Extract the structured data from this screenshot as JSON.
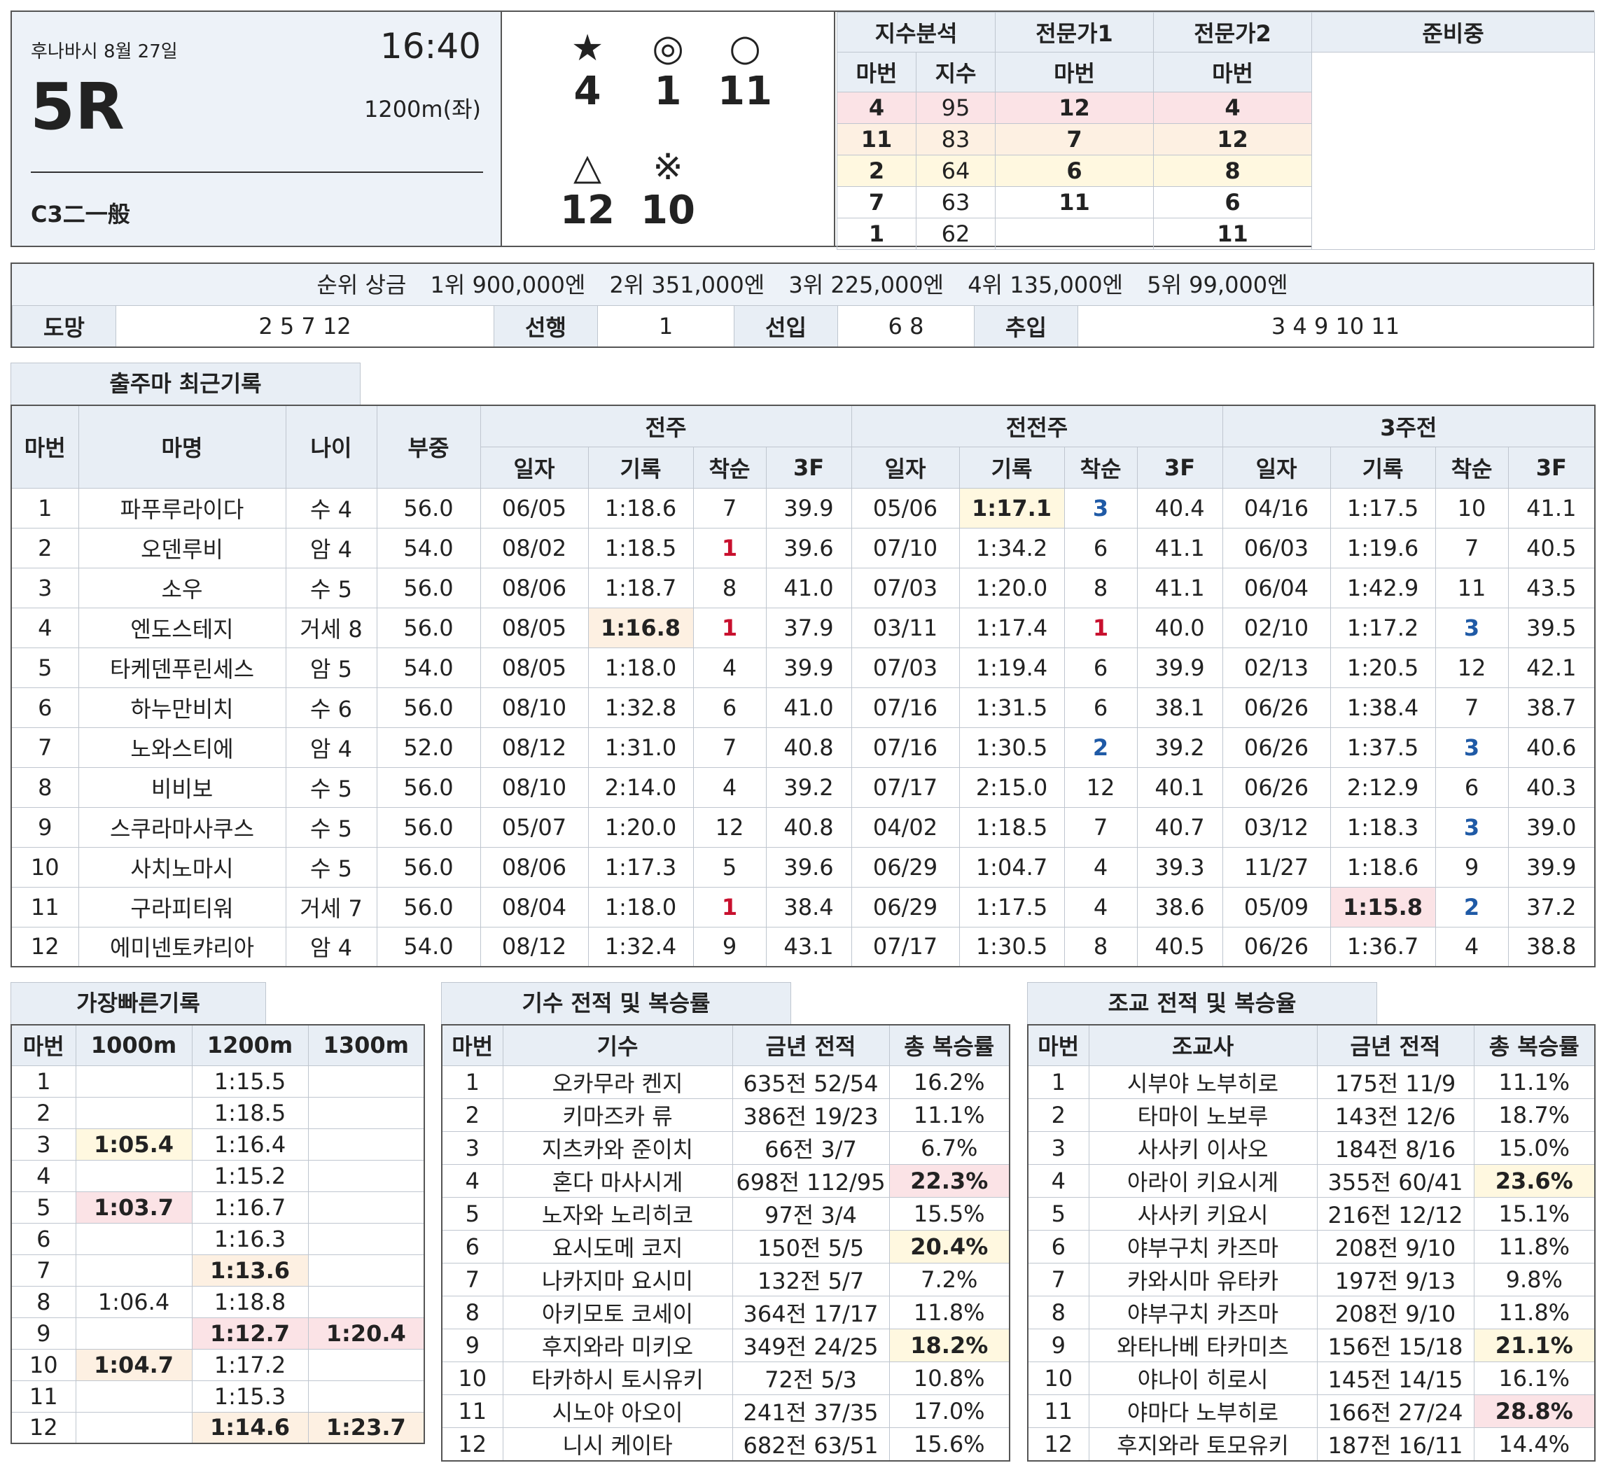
{
  "race": {
    "venue_date": "후나바시 8월 27일",
    "time": "16:40",
    "number": "5R",
    "distance": "1200m(좌)",
    "class": "C3二一般"
  },
  "picks": [
    {
      "symbol": "★",
      "horse": "4"
    },
    {
      "symbol": "◎",
      "horse": "1"
    },
    {
      "symbol": "○",
      "horse": "11"
    },
    {
      "symbol": "△",
      "horse": "12"
    },
    {
      "symbol": "※",
      "horse": "10"
    }
  ],
  "analysis": {
    "headers": {
      "index": "지수분석",
      "expert1": "전문가1",
      "expert2": "전문가2",
      "preparing": "준비중"
    },
    "subheaders": {
      "horse_no": "마번",
      "score": "지수"
    },
    "rows": [
      {
        "idx_horse": "4",
        "idx_score": "95",
        "exp1": "12",
        "exp2": "4"
      },
      {
        "idx_horse": "11",
        "idx_score": "83",
        "exp1": "7",
        "exp2": "12"
      },
      {
        "idx_horse": "2",
        "idx_score": "64",
        "exp1": "6",
        "exp2": "8"
      },
      {
        "idx_horse": "7",
        "idx_score": "63",
        "exp1": "11",
        "exp2": "6"
      },
      {
        "idx_horse": "1",
        "idx_score": "62",
        "exp1": "",
        "exp2": "11"
      }
    ]
  },
  "prizes": {
    "label": "순위 상금",
    "items": [
      "1위 900,000엔",
      "2위 351,000엔",
      "3위 225,000엔",
      "4위 135,000엔",
      "5위 99,000엔"
    ]
  },
  "running_style": [
    {
      "label": "도망",
      "horses": "2  5  7  12"
    },
    {
      "label": "선행",
      "horses": "1"
    },
    {
      "label": "선입",
      "horses": "6  8"
    },
    {
      "label": "추입",
      "horses": "3  4  9  10  11"
    }
  ],
  "records": {
    "tab": "출주마 최근기록",
    "headers": {
      "horse_no": "마번",
      "name": "마명",
      "age": "나이",
      "weight": "부중",
      "last": "전주",
      "prev": "전전주",
      "third": "3주전"
    },
    "sub": {
      "date": "일자",
      "time": "기록",
      "rank": "착순",
      "f3": "3F"
    },
    "rows": [
      {
        "no": "1",
        "name": "파푸루라이다",
        "age": "수 4",
        "wt": "56.0",
        "r": [
          [
            "06/05",
            "1:18.6",
            "7",
            "39.9"
          ],
          [
            "05/06",
            "1:17.1",
            "3",
            "40.4"
          ],
          [
            "04/16",
            "1:17.5",
            "10",
            "41.1"
          ]
        ]
      },
      {
        "no": "2",
        "name": "오덴루비",
        "age": "암 4",
        "wt": "54.0",
        "r": [
          [
            "08/02",
            "1:18.5",
            "1",
            "39.6"
          ],
          [
            "07/10",
            "1:34.2",
            "6",
            "41.1"
          ],
          [
            "06/03",
            "1:19.6",
            "7",
            "40.5"
          ]
        ]
      },
      {
        "no": "3",
        "name": "소우",
        "age": "수 5",
        "wt": "56.0",
        "r": [
          [
            "08/06",
            "1:18.7",
            "8",
            "41.0"
          ],
          [
            "07/03",
            "1:20.0",
            "8",
            "41.1"
          ],
          [
            "06/04",
            "1:42.9",
            "11",
            "43.5"
          ]
        ]
      },
      {
        "no": "4",
        "name": "엔도스테지",
        "age": "거세 8",
        "wt": "56.0",
        "r": [
          [
            "08/05",
            "1:16.8",
            "1",
            "37.9"
          ],
          [
            "03/11",
            "1:17.4",
            "1",
            "40.0"
          ],
          [
            "02/10",
            "1:17.2",
            "3",
            "39.5"
          ]
        ]
      },
      {
        "no": "5",
        "name": "타케덴푸린세스",
        "age": "암 5",
        "wt": "54.0",
        "r": [
          [
            "08/05",
            "1:18.0",
            "4",
            "39.9"
          ],
          [
            "07/03",
            "1:19.4",
            "6",
            "39.9"
          ],
          [
            "02/13",
            "1:20.5",
            "12",
            "42.1"
          ]
        ]
      },
      {
        "no": "6",
        "name": "하누만비치",
        "age": "수 6",
        "wt": "56.0",
        "r": [
          [
            "08/10",
            "1:32.8",
            "6",
            "41.0"
          ],
          [
            "07/16",
            "1:31.5",
            "6",
            "38.1"
          ],
          [
            "06/26",
            "1:38.4",
            "7",
            "38.7"
          ]
        ]
      },
      {
        "no": "7",
        "name": "노와스티에",
        "age": "암 4",
        "wt": "52.0",
        "r": [
          [
            "08/12",
            "1:31.0",
            "7",
            "40.8"
          ],
          [
            "07/16",
            "1:30.5",
            "2",
            "39.2"
          ],
          [
            "06/26",
            "1:37.5",
            "3",
            "40.6"
          ]
        ]
      },
      {
        "no": "8",
        "name": "비비보",
        "age": "수 5",
        "wt": "56.0",
        "r": [
          [
            "08/10",
            "2:14.0",
            "4",
            "39.2"
          ],
          [
            "07/17",
            "2:15.0",
            "12",
            "40.1"
          ],
          [
            "06/26",
            "2:12.9",
            "6",
            "40.3"
          ]
        ]
      },
      {
        "no": "9",
        "name": "스쿠라마사쿠스",
        "age": "수 5",
        "wt": "56.0",
        "r": [
          [
            "05/07",
            "1:20.0",
            "12",
            "40.8"
          ],
          [
            "04/02",
            "1:18.5",
            "7",
            "40.7"
          ],
          [
            "03/12",
            "1:18.3",
            "3",
            "39.0"
          ]
        ]
      },
      {
        "no": "10",
        "name": "사치노마시",
        "age": "수 5",
        "wt": "56.0",
        "r": [
          [
            "08/06",
            "1:17.3",
            "5",
            "39.6"
          ],
          [
            "06/29",
            "1:04.7",
            "4",
            "39.3"
          ],
          [
            "11/27",
            "1:18.6",
            "9",
            "39.9"
          ]
        ]
      },
      {
        "no": "11",
        "name": "구라피티워",
        "age": "거세 7",
        "wt": "56.0",
        "r": [
          [
            "08/04",
            "1:18.0",
            "1",
            "38.4"
          ],
          [
            "06/29",
            "1:17.5",
            "4",
            "38.6"
          ],
          [
            "05/09",
            "1:15.8",
            "2",
            "37.2"
          ]
        ]
      },
      {
        "no": "12",
        "name": "에미넨토캬리아",
        "age": "암 4",
        "wt": "54.0",
        "r": [
          [
            "08/12",
            "1:32.4",
            "9",
            "43.1"
          ],
          [
            "07/17",
            "1:30.5",
            "8",
            "40.5"
          ],
          [
            "06/26",
            "1:36.7",
            "4",
            "38.8"
          ]
        ]
      }
    ]
  },
  "fastest": {
    "tab": "가장빠른기록",
    "headers": [
      "마번",
      "1000m",
      "1200m",
      "1300m"
    ],
    "rows": [
      [
        "1",
        "",
        "1:15.5",
        ""
      ],
      [
        "2",
        "",
        "1:18.5",
        ""
      ],
      [
        "3",
        "1:05.4",
        "1:16.4",
        ""
      ],
      [
        "4",
        "",
        "1:15.2",
        ""
      ],
      [
        "5",
        "1:03.7",
        "1:16.7",
        ""
      ],
      [
        "6",
        "",
        "1:16.3",
        ""
      ],
      [
        "7",
        "",
        "1:13.6",
        ""
      ],
      [
        "8",
        "1:06.4",
        "1:18.8",
        ""
      ],
      [
        "9",
        "",
        "1:12.7",
        "1:20.4"
      ],
      [
        "10",
        "1:04.7",
        "1:17.2",
        ""
      ],
      [
        "11",
        "",
        "1:15.3",
        ""
      ],
      [
        "12",
        "",
        "1:14.6",
        "1:23.7"
      ]
    ]
  },
  "jockeys": {
    "tab": "기수 전적 및 복승률",
    "headers": [
      "마번",
      "기수",
      "금년 전적",
      "총 복승률"
    ],
    "rows": [
      [
        "1",
        "오카무라 켄지",
        "635전 52/54",
        "16.2%"
      ],
      [
        "2",
        "키마즈카 류",
        "386전 19/23",
        "11.1%"
      ],
      [
        "3",
        "지츠카와 준이치",
        "66전 3/7",
        "6.7%"
      ],
      [
        "4",
        "혼다 마사시게",
        "698전 112/95",
        "22.3%"
      ],
      [
        "5",
        "노자와 노리히코",
        "97전 3/4",
        "15.5%"
      ],
      [
        "6",
        "요시도메 코지",
        "150전 5/5",
        "20.4%"
      ],
      [
        "7",
        "나카지마 요시미",
        "132전 5/7",
        "7.2%"
      ],
      [
        "8",
        "아키모토 코세이",
        "364전 17/17",
        "11.8%"
      ],
      [
        "9",
        "후지와라 미키오",
        "349전 24/25",
        "18.2%"
      ],
      [
        "10",
        "타카하시 토시유키",
        "72전 5/3",
        "10.8%"
      ],
      [
        "11",
        "시노야 아오이",
        "241전 37/35",
        "17.0%"
      ],
      [
        "12",
        "니시 케이타",
        "682전 63/51",
        "15.6%"
      ]
    ]
  },
  "trainers": {
    "tab": "조교 전적 및 복승율",
    "headers": [
      "마번",
      "조교사",
      "금년 전적",
      "총 복승률"
    ],
    "rows": [
      [
        "1",
        "시부야 노부히로",
        "175전 11/9",
        "11.1%"
      ],
      [
        "2",
        "타마이 노보루",
        "143전 12/6",
        "18.7%"
      ],
      [
        "3",
        "사사키 이사오",
        "184전 8/16",
        "15.0%"
      ],
      [
        "4",
        "아라이 키요시게",
        "355전 60/41",
        "23.6%"
      ],
      [
        "5",
        "사사키 키요시",
        "216전 12/12",
        "15.1%"
      ],
      [
        "6",
        "야부구치 카즈마",
        "208전 9/10",
        "11.8%"
      ],
      [
        "7",
        "카와시마 유타카",
        "197전 9/13",
        "9.8%"
      ],
      [
        "8",
        "야부구치 카즈마",
        "208전 9/10",
        "11.8%"
      ],
      [
        "9",
        "와타나베 타카미츠",
        "156전 15/18",
        "21.1%"
      ],
      [
        "10",
        "야나이 히로시",
        "145전 14/15",
        "16.1%"
      ],
      [
        "11",
        "야마다 노부히로",
        "166전 27/24",
        "28.8%"
      ],
      [
        "12",
        "후지와라 토모유키",
        "187전 16/11",
        "14.4%"
      ]
    ]
  }
}
